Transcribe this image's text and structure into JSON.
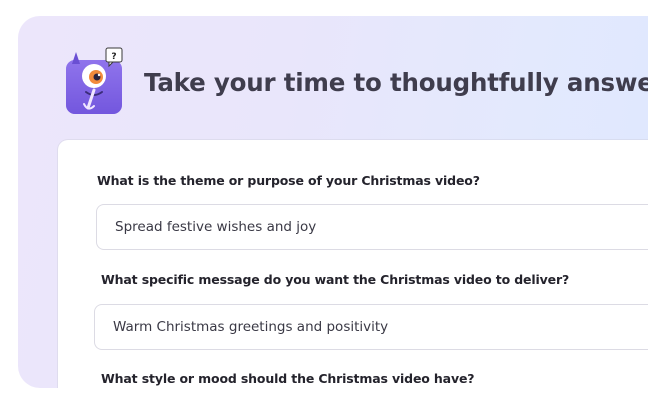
{
  "header": {
    "title": "Take your time to thoughtfully answer th",
    "mascot": {
      "icon": "monster-mascot-icon",
      "badge": "?"
    }
  },
  "form": {
    "questions": [
      {
        "label": "What is the theme or purpose of your Christmas video?",
        "value": "Spread festive wishes and joy"
      },
      {
        "label": "What specific message do you want the Christmas video to deliver?",
        "value": "Warm Christmas greetings and positivity"
      },
      {
        "label": "What style or mood should the Christmas video have?"
      }
    ]
  },
  "colors": {
    "panel_bg_start": "#ece6fb",
    "panel_bg_end": "#dfe8ff",
    "mascot_purple": "#7f63e6",
    "title_text": "#3f3d4d"
  }
}
